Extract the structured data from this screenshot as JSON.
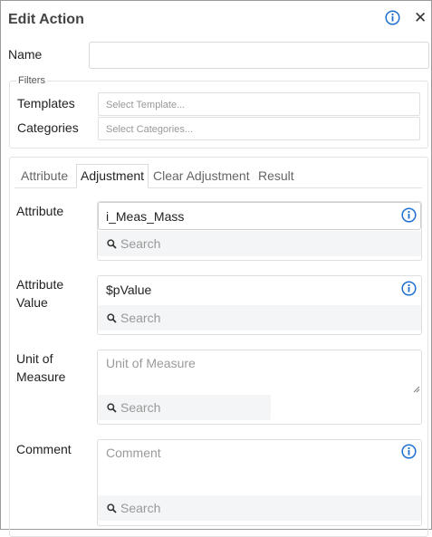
{
  "dialog": {
    "title": "Edit Action",
    "info_icon": "info-circle-icon",
    "close_label": "✕"
  },
  "name": {
    "label": "Name",
    "value": ""
  },
  "filters": {
    "legend": "Filters",
    "templates_label": "Templates",
    "templates_placeholder": "Select Template...",
    "categories_label": "Categories",
    "categories_placeholder": "Select Categories..."
  },
  "tabs": [
    {
      "label": "Attribute",
      "active": false
    },
    {
      "label": "Adjustment",
      "active": true
    },
    {
      "label": "Clear Adjustment",
      "active": false
    },
    {
      "label": "Result",
      "active": false
    }
  ],
  "fields": {
    "attribute": {
      "label": "Attribute",
      "value": "i_Meas_Mass",
      "search_placeholder": "Search"
    },
    "attribute_value": {
      "label_line1": "Attribute",
      "label_line2": "Value",
      "value": "$pValue",
      "search_placeholder": "Search"
    },
    "unit_of_measure": {
      "label_line1": "Unit of",
      "label_line2": "Measure",
      "placeholder": "Unit of Measure",
      "search_placeholder": "Search"
    },
    "comment": {
      "label": "Comment",
      "placeholder": "Comment",
      "search_placeholder": "Search"
    }
  },
  "colors": {
    "info_blue": "#1f6fd1",
    "search_bg": "#f4f5f6"
  }
}
